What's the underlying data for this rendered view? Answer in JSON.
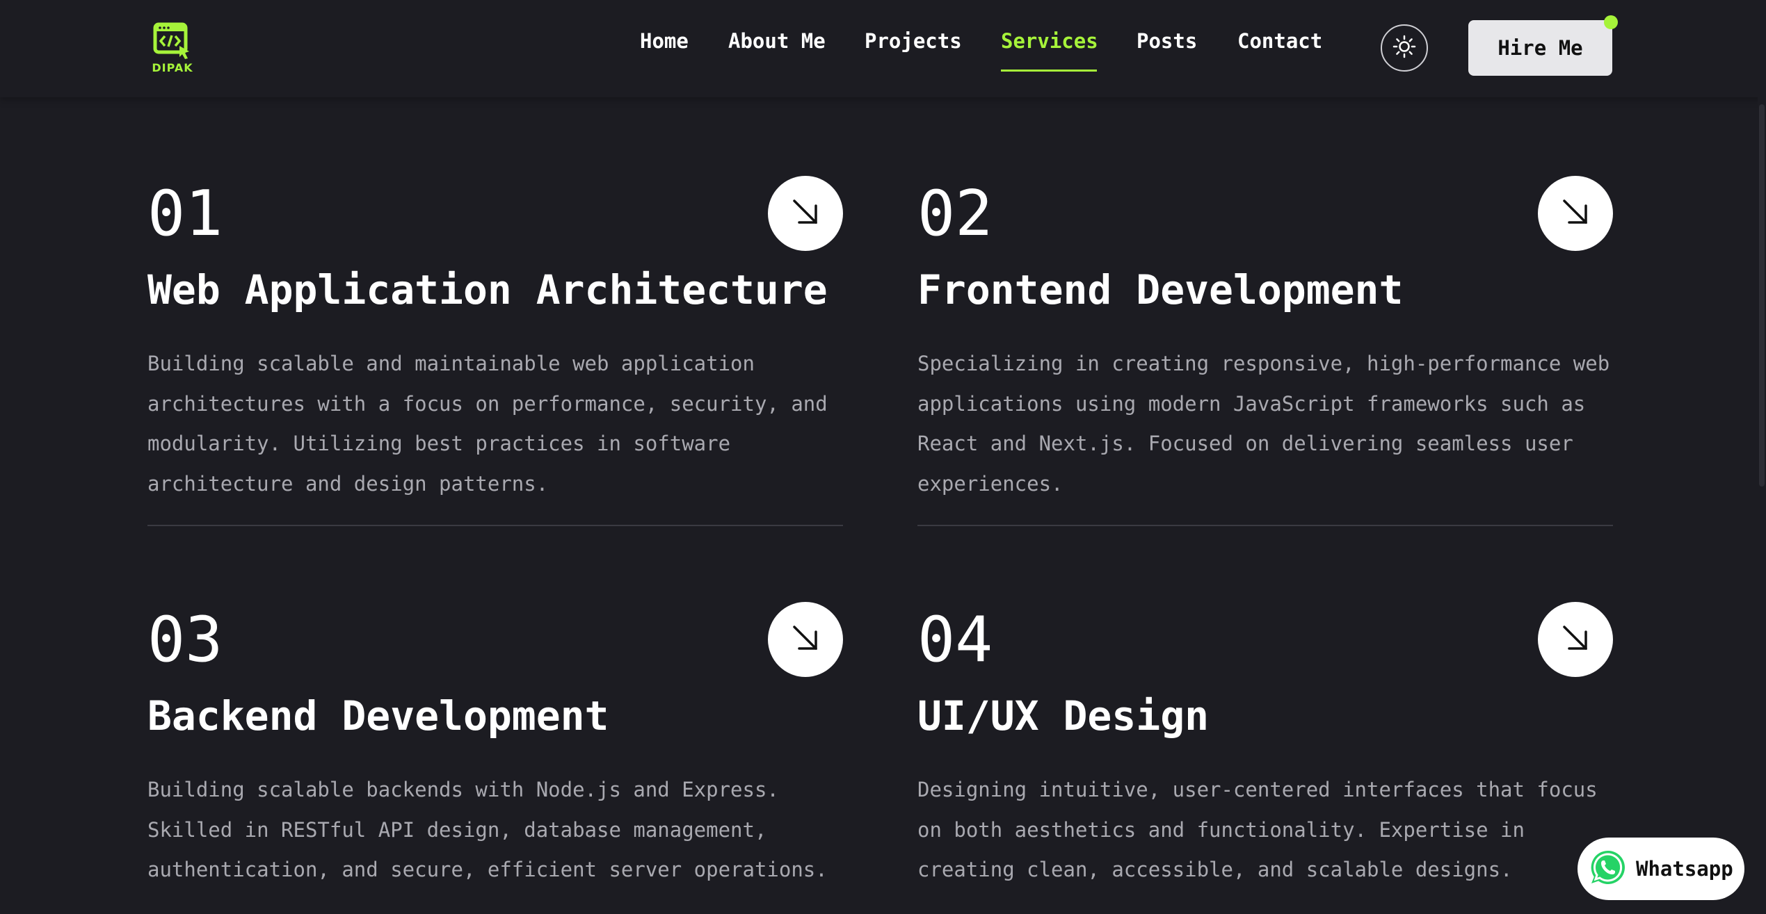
{
  "brand": {
    "name": "DIPAK",
    "accent_color": "#a6f33a"
  },
  "nav": {
    "items": [
      {
        "label": "Home",
        "active": false
      },
      {
        "label": "About Me",
        "active": false
      },
      {
        "label": "Projects",
        "active": false
      },
      {
        "label": "Services",
        "active": true
      },
      {
        "label": "Posts",
        "active": false
      },
      {
        "label": "Contact",
        "active": false
      }
    ]
  },
  "header": {
    "theme_toggle_icon": "sun-icon",
    "hire_label": "Hire Me"
  },
  "services": [
    {
      "number": "01",
      "title": "Web Application Architecture",
      "description": "Building scalable and maintainable web application architectures with a focus on performance, security, and modularity. Utilizing best practices in software architecture and design patterns."
    },
    {
      "number": "02",
      "title": "Frontend Development",
      "description": "Specializing in creating responsive, high-performance web applications using modern JavaScript frameworks such as React and Next.js. Focused on delivering seamless user experiences."
    },
    {
      "number": "03",
      "title": "Backend Development",
      "description": "Building scalable backends with Node.js and Express. Skilled in RESTful API design, database management, authentication, and secure, efficient server operations."
    },
    {
      "number": "04",
      "title": "UI/UX Design",
      "description": "Designing intuitive, user-centered interfaces that focus on both aesthetics and functionality. Expertise in creating clean, accessible, and scalable designs."
    }
  ],
  "whatsapp": {
    "label": "Whatsapp",
    "icon": "whatsapp-icon"
  },
  "colors": {
    "background": "#1c1c22",
    "text": "#ffffff",
    "muted": "#a9a9b0",
    "accent": "#a6f33a"
  }
}
